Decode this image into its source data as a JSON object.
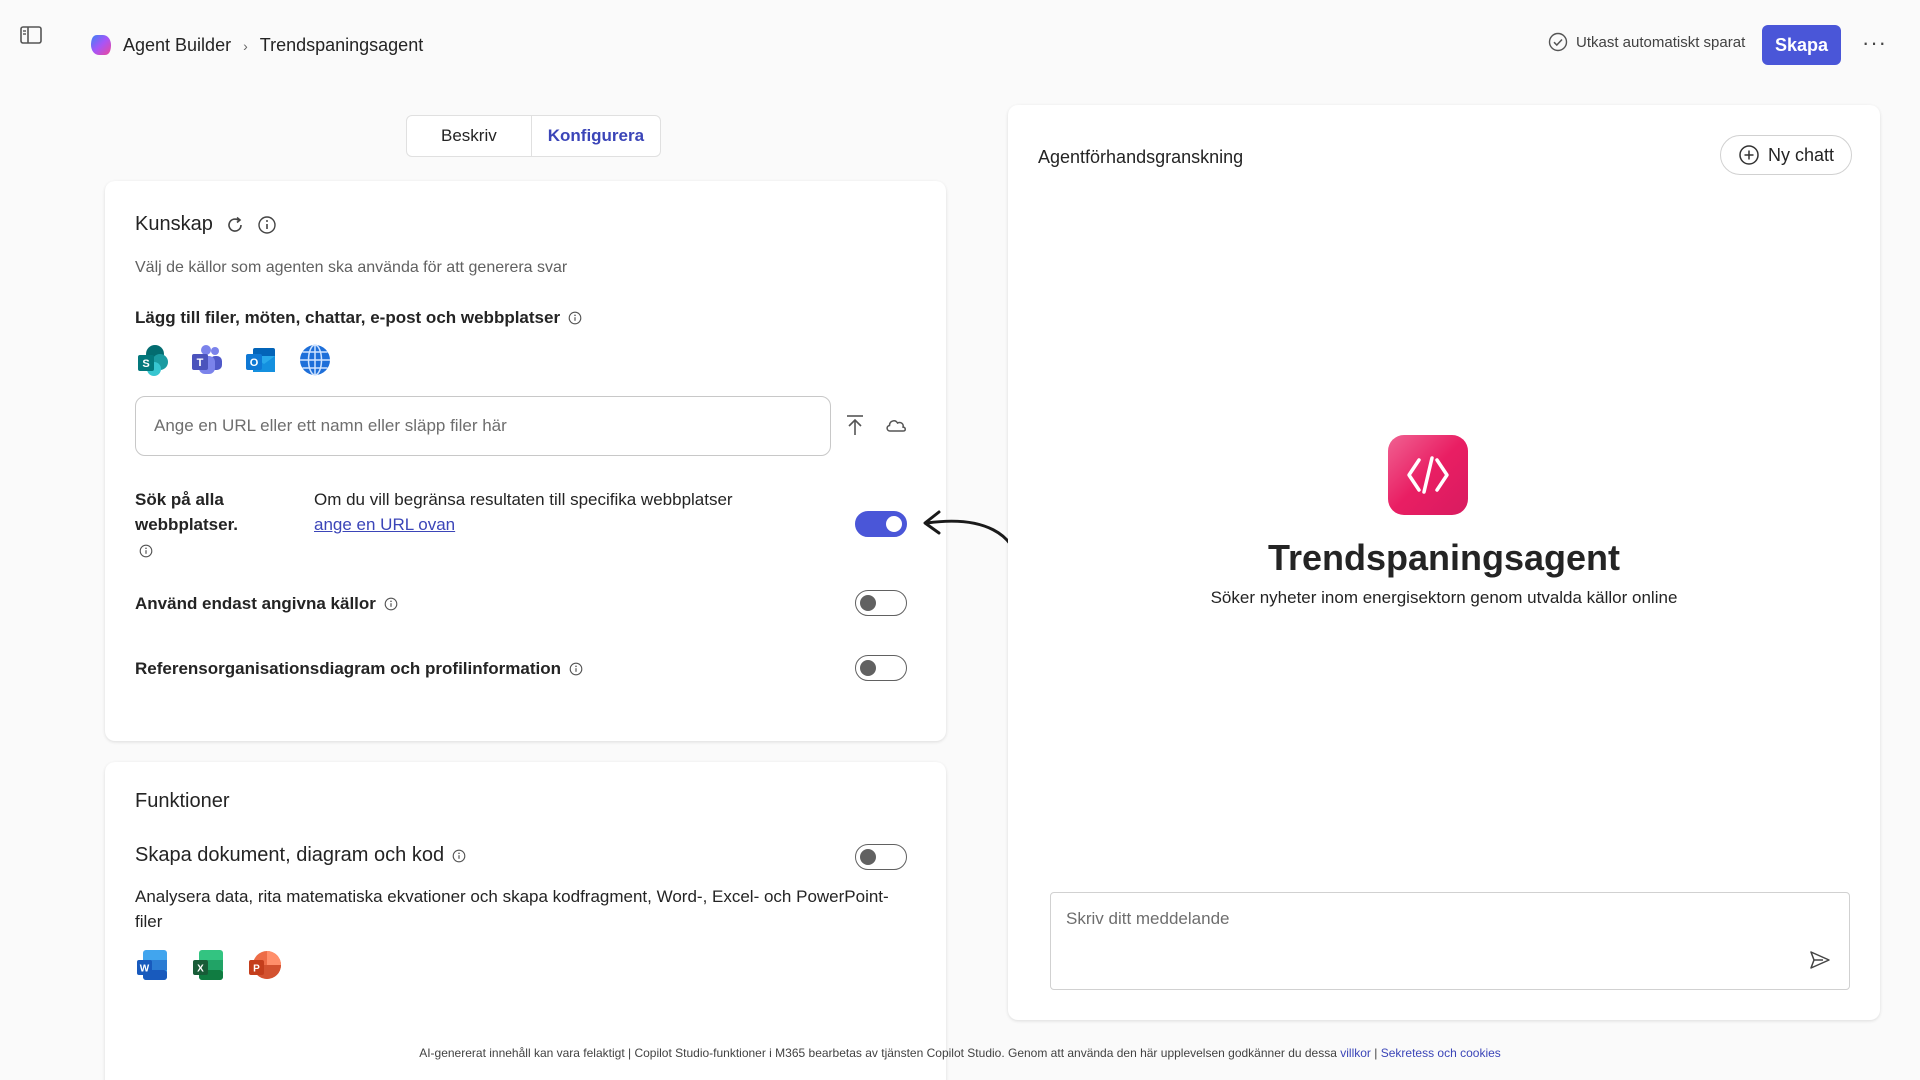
{
  "header": {
    "breadcrumb_root": "Agent Builder",
    "breadcrumb_sep": "›",
    "breadcrumb_current": "Trendspaningsagent",
    "saved_status": "Utkast automatiskt sparat",
    "create_label": "Skapa",
    "more_label": "···"
  },
  "tabs": [
    {
      "label": "Beskriv",
      "active": false
    },
    {
      "label": "Konfigurera",
      "active": true
    }
  ],
  "knowledge": {
    "title": "Kunskap",
    "subtitle": "Välj de källor som agenten ska använda för att generera svar",
    "add_label": "Lägg till filer, möten, chattar, e-post och webbplatser",
    "source_icons": [
      "sharepoint-icon",
      "teams-icon",
      "outlook-icon",
      "globe-icon"
    ],
    "url_placeholder": "Ange en URL eller ett namn eller släpp filer här",
    "search_all_label": "Sök på alla webbplatser.",
    "search_all_desc": "Om du vill begränsa resultaten till specifika webbplatser",
    "search_all_link": "ange en URL ovan",
    "search_all_on": true,
    "only_sources_label": "Använd endast angivna källor",
    "only_sources_on": false,
    "org_label": "Referensorganisationsdiagram och profilinformation",
    "org_on": false
  },
  "functions": {
    "title": "Funktioner",
    "create_docs_label": "Skapa dokument, diagram och kod",
    "create_docs_desc": "Analysera data, rita matematiska ekvationer och skapa kodfragment, Word-, Excel- och PowerPoint-filer",
    "create_docs_on": false,
    "app_icons": [
      "word-icon",
      "excel-icon",
      "powerpoint-icon"
    ]
  },
  "preview": {
    "title": "Agentförhandsgranskning",
    "new_chat_label": "Ny chatt",
    "agent_name": "Trendspaningsagent",
    "agent_desc": "Söker nyheter inom energisektorn genom utvalda källor online",
    "message_placeholder": "Skriv ditt meddelande"
  },
  "footer": {
    "text": "AI-genererat innehåll kan vara felaktigt | Copilot Studio-funktioner i M365 bearbetas av tjänsten Copilot Studio. Genom att använda den här upplevelsen godkänner du dessa",
    "terms_link": "villkor",
    "separator": "|",
    "privacy_link": "Sekretess och cookies"
  },
  "colors": {
    "accent": "#4a56d8",
    "link": "#3b45b8",
    "agent_logo": "#e91e63"
  }
}
